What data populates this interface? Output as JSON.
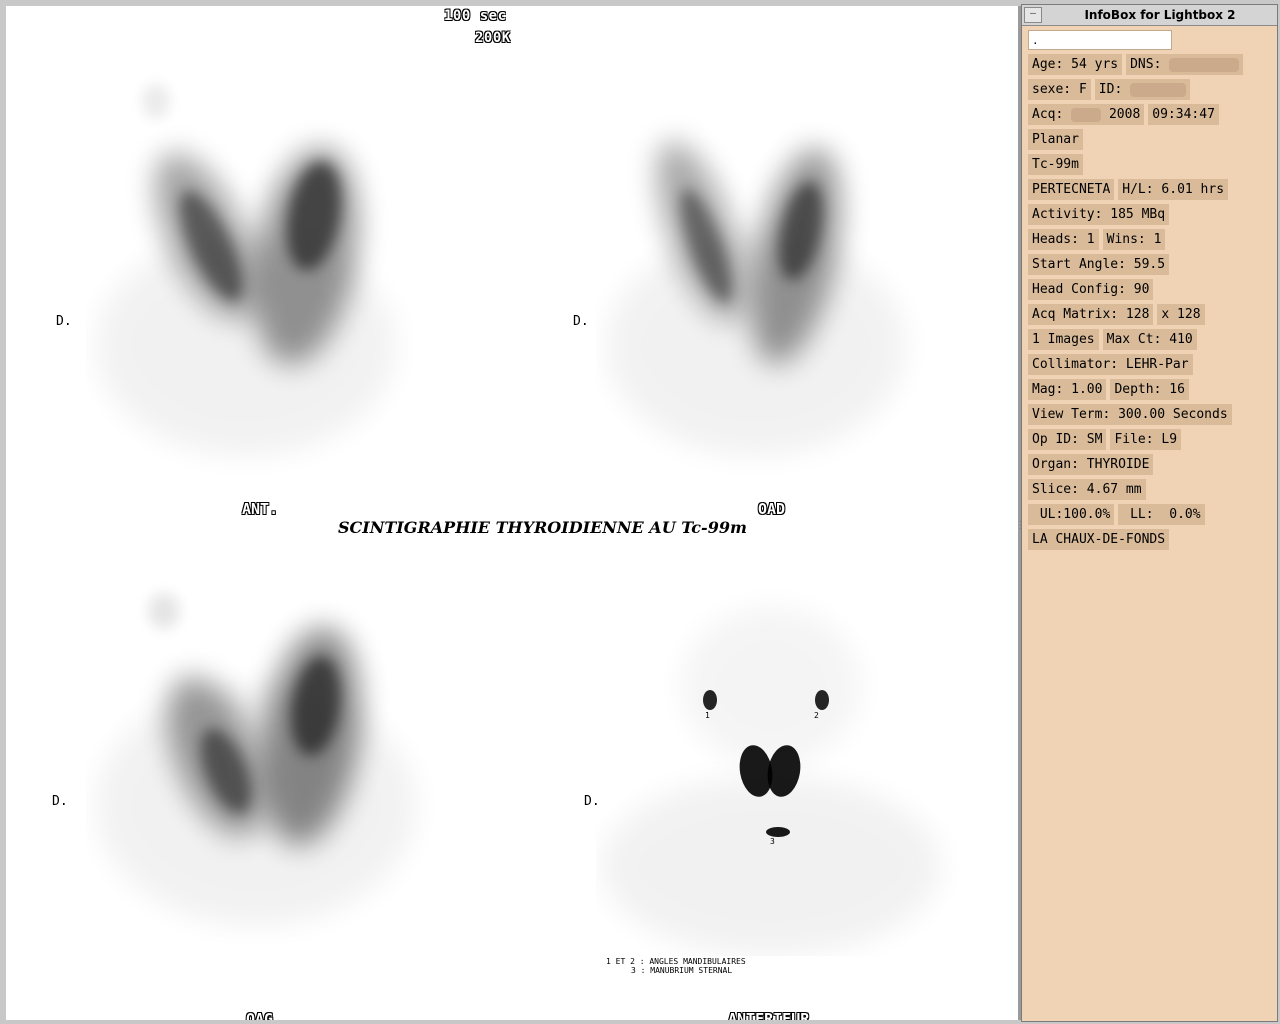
{
  "lightbox": {
    "time_label": "100 sec",
    "counts_label": "200K",
    "main_title": "SCINTIGRAPHIE THYROIDIENNE AU Tc-99m",
    "side_marker": "D.",
    "views": {
      "top_left": "ANT.",
      "top_right": "OAD",
      "bottom_left": "OAG",
      "bottom_right": "ANTERIEUR"
    },
    "markers": [
      "1",
      "2",
      "3"
    ],
    "legend": {
      "line1": "1 ET 2 : ANGLES MANDIBULAIRES",
      "line2": "3 : MANUBRIUM STERNAL"
    }
  },
  "infobox": {
    "title": "InfoBox for Lightbox 2",
    "close_glyph": "—",
    "patient_name": ".",
    "age": "Age: 54 yrs",
    "dns": "DNS:",
    "sex": "sexe: F",
    "id": "ID:",
    "acq_date_prefix": "Acq:",
    "acq_date_suffix": "2008",
    "acq_time": "09:34:47",
    "mode": "Planar",
    "isotope": "Tc-99m",
    "tracer": "PERTECNETA",
    "half_life": "H/L: 6.01 hrs",
    "activity": "Activity: 185 MBq",
    "heads": "Heads: 1",
    "wins": "Wins: 1",
    "start_angle": "Start Angle: 59.5",
    "head_config": "Head Config: 90",
    "acq_matrix": "Acq Matrix: 128",
    "acq_matrix_y": "x 128",
    "images": "1 Images",
    "max_ct": "Max Ct: 410",
    "collimator": "Collimator: LEHR-Par",
    "mag": "Mag: 1.00",
    "depth": "Depth: 16",
    "view_term": "View Term: 300.00 Seconds",
    "op_id": "Op ID: SM",
    "file": "File: L9",
    "organ": "Organ: THYROIDE",
    "slice": "Slice: 4.67 mm",
    "ul": " UL:100.0%",
    "ll": " LL:  0.0%",
    "site": "LA CHAUX-DE-FONDS"
  },
  "colors": {
    "infobox_bg": "#efd3b4",
    "cell_bg": "#d9bb9a",
    "image_bg": "#ffffff"
  }
}
